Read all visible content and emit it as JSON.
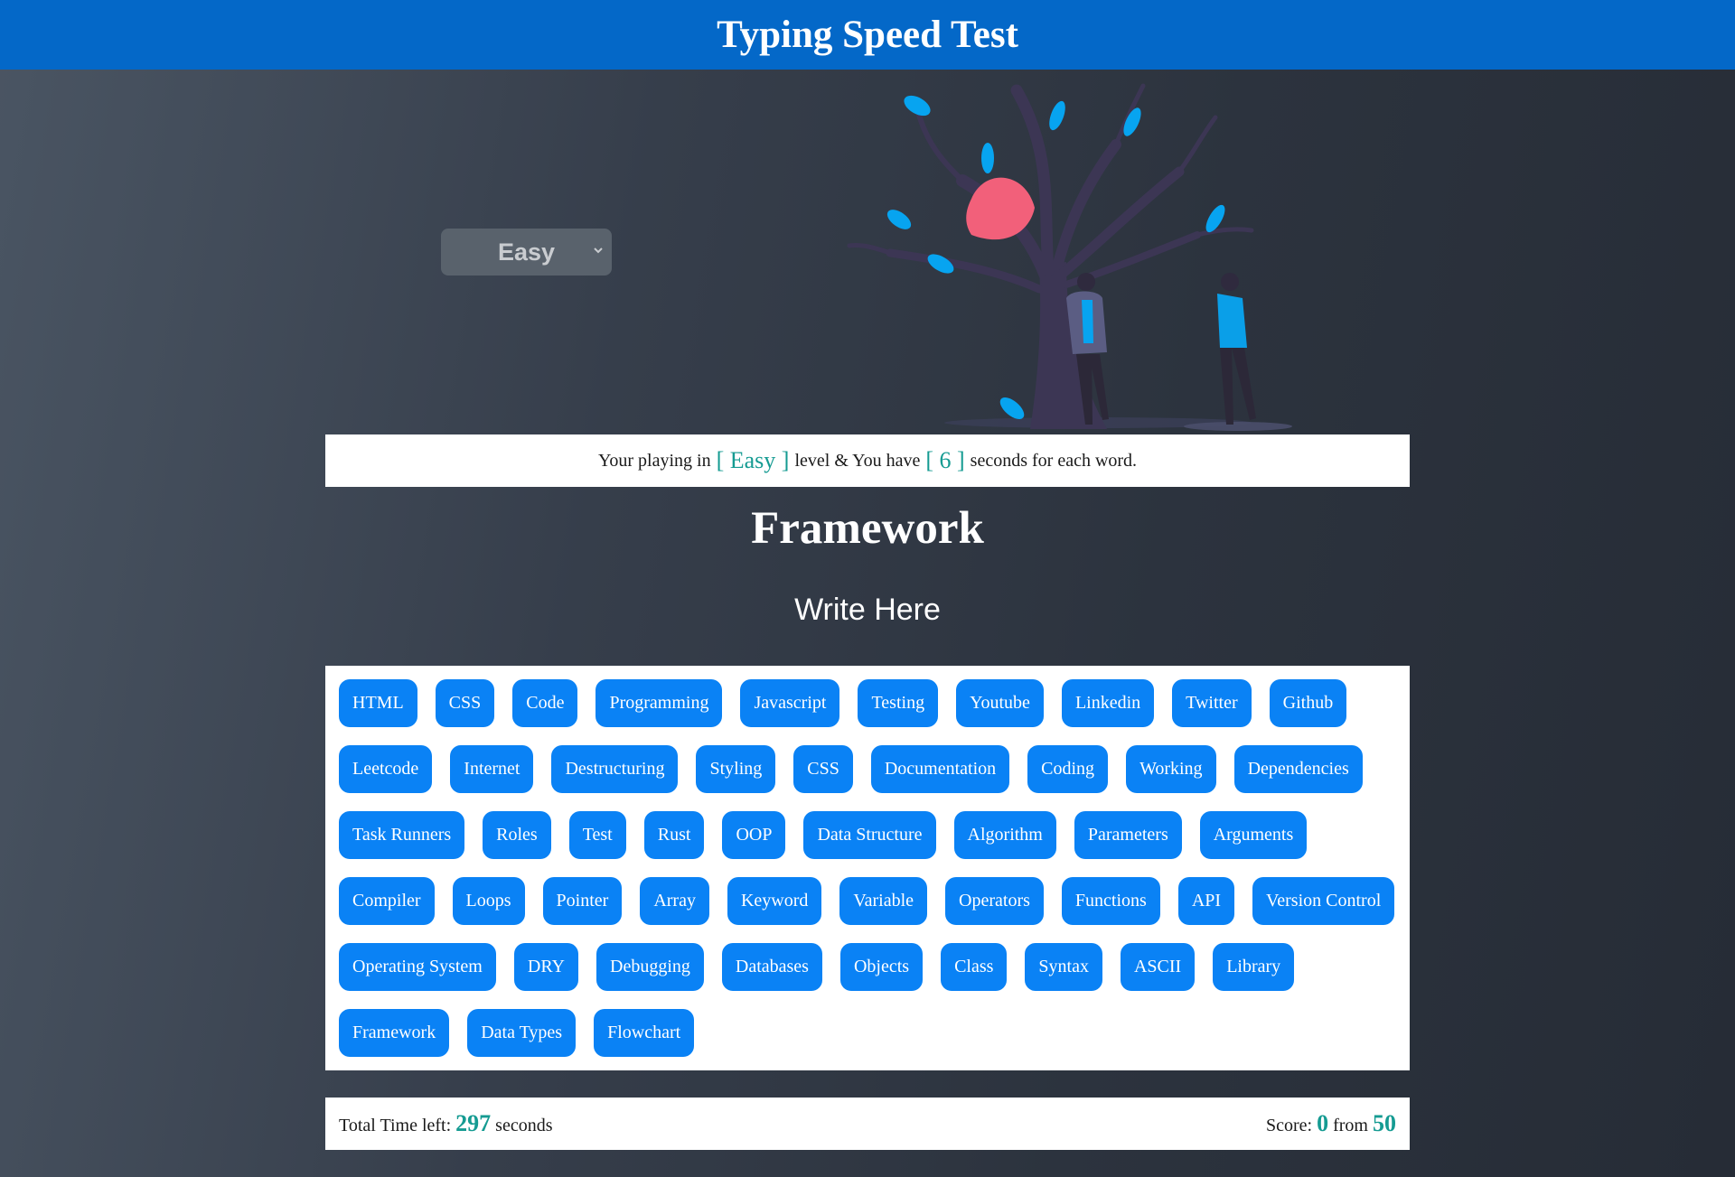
{
  "header": {
    "title": "Typing Speed Test"
  },
  "level_select": {
    "selected": "Easy"
  },
  "info": {
    "prefix": "Your playing in",
    "level": "[ Easy ]",
    "middle": "level & You have",
    "seconds": "[ 6 ]",
    "suffix": "seconds for each word."
  },
  "current_word": "Framework",
  "input": {
    "placeholder": "Write Here"
  },
  "words": [
    "HTML",
    "CSS",
    "Code",
    "Programming",
    "Javascript",
    "Testing",
    "Youtube",
    "Linkedin",
    "Twitter",
    "Github",
    "Leetcode",
    "Internet",
    "Destructuring",
    "Styling",
    "CSS",
    "Documentation",
    "Coding",
    "Working",
    "Dependencies",
    "Task Runners",
    "Roles",
    "Test",
    "Rust",
    "OOP",
    "Data Structure",
    "Algorithm",
    "Parameters",
    "Arguments",
    "Compiler",
    "Loops",
    "Pointer",
    "Array",
    "Keyword",
    "Variable",
    "Operators",
    "Functions",
    "API",
    "Version Control",
    "Operating System",
    "DRY",
    "Debugging",
    "Databases",
    "Objects",
    "Class",
    "Syntax",
    "ASCII",
    "Library",
    "Framework",
    "Data Types",
    "Flowchart"
  ],
  "footer": {
    "time_label": "Total Time left:",
    "time_value": "297",
    "time_unit": "seconds",
    "score_label": "Score:",
    "score_value": "0",
    "score_from": "from",
    "score_total": "50"
  },
  "colors": {
    "header": "#0468c8",
    "chip": "#0a82f5",
    "highlight": "#159b92"
  }
}
